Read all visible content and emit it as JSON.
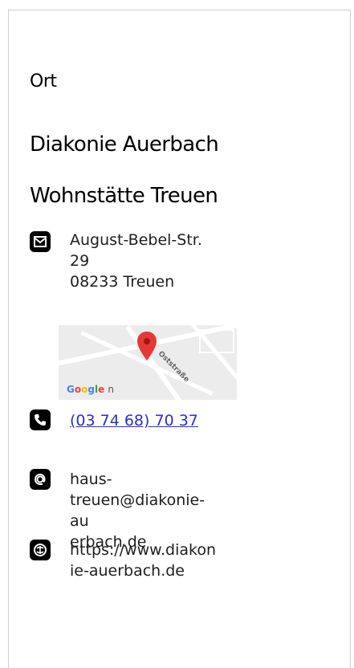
{
  "section_label": "Ort",
  "org_line1": "Diakonie Auerbach",
  "org_line2": "Wohnstätte Treuen",
  "address": {
    "icon": "envelope-icon",
    "street": "August-Bebel-Str.",
    "number": "29",
    "city": "08233 Treuen"
  },
  "map": {
    "brand_letters": [
      "G",
      "o",
      "o",
      "g",
      "l",
      "e"
    ],
    "brand_suffix": "n",
    "street_label": "Oststraße",
    "pin_color": "#e53935"
  },
  "phone": {
    "icon": "phone-icon",
    "number": "(03 74 68) 70 37"
  },
  "email": {
    "icon": "at-icon",
    "line1": "haus-",
    "line2": "treuen@diakonie-au",
    "line3": "erbach.de"
  },
  "website": {
    "icon": "globe-icon",
    "line1": "https://www.diakon",
    "line2": "ie-auerbach.de"
  }
}
